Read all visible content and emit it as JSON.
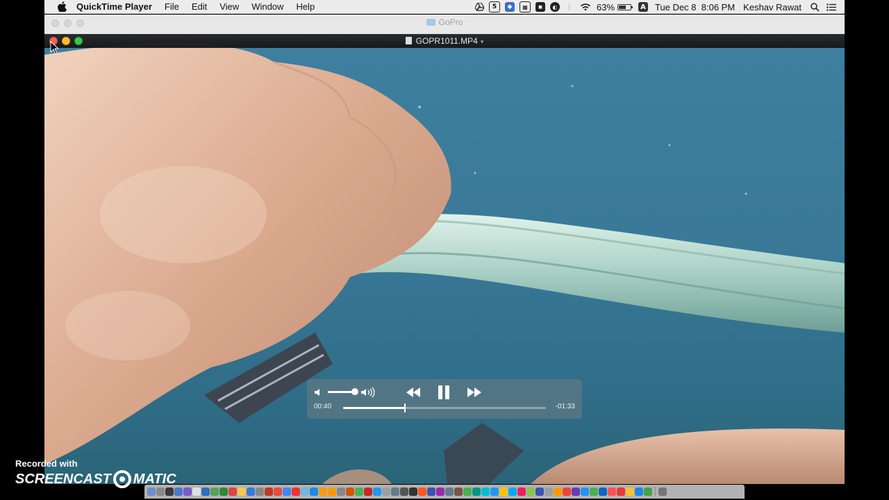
{
  "menubar": {
    "app_name": "QuickTime Player",
    "menus": [
      "File",
      "Edit",
      "View",
      "Window",
      "Help"
    ],
    "battery_percent": "63%",
    "battery_level": 0.63,
    "clock": "Tue Dec 8  8:06 PM",
    "user": "Keshav Rawat",
    "input_source": "A"
  },
  "background_window": {
    "title": "GoPro"
  },
  "player": {
    "title": "GOPR1011.MP4",
    "elapsed": "00:40",
    "remaining": "-01:33",
    "progress": 0.305,
    "volume": 0.9,
    "state": "playing"
  },
  "watermark": {
    "recorded_with": "Recorded with",
    "brand_left": "SCREENCAST",
    "brand_right": "MATIC"
  },
  "dock": {
    "icon_colors": [
      "#6b8fc9",
      "#8a8a8a",
      "#3a3a3a",
      "#4a78c8",
      "#7a5ac8",
      "#e0e0e0",
      "#2f6fb8",
      "#5aa05a",
      "#2b8a3e",
      "#d44",
      "#f2c94c",
      "#3a7bd5",
      "#888",
      "#c0392b",
      "#e74c3c",
      "#4285f4",
      "#e33",
      "#6fb8e0",
      "#1e88e5",
      "#f39c12",
      "#ff9800",
      "#888",
      "#d35400",
      "#4caf50",
      "#c62828",
      "#2196f3",
      "#9e9e9e",
      "#607d8b",
      "#555",
      "#333",
      "#ff5722",
      "#3f51b5",
      "#9c27b0",
      "#607d8b",
      "#795548",
      "#4caf50",
      "#009688",
      "#00bcd4",
      "#2196f3",
      "#ffc107",
      "#03a9f4",
      "#e91e63",
      "#8bc34a",
      "#3f51b5",
      "#9e9e9e",
      "#ff9800",
      "#f44336",
      "#673ab7",
      "#2196f3",
      "#4caf50",
      "#1565c0",
      "#ff5252",
      "#e53935",
      "#fbc02d",
      "#1e88e5",
      "#43a047",
      "#757575"
    ]
  }
}
